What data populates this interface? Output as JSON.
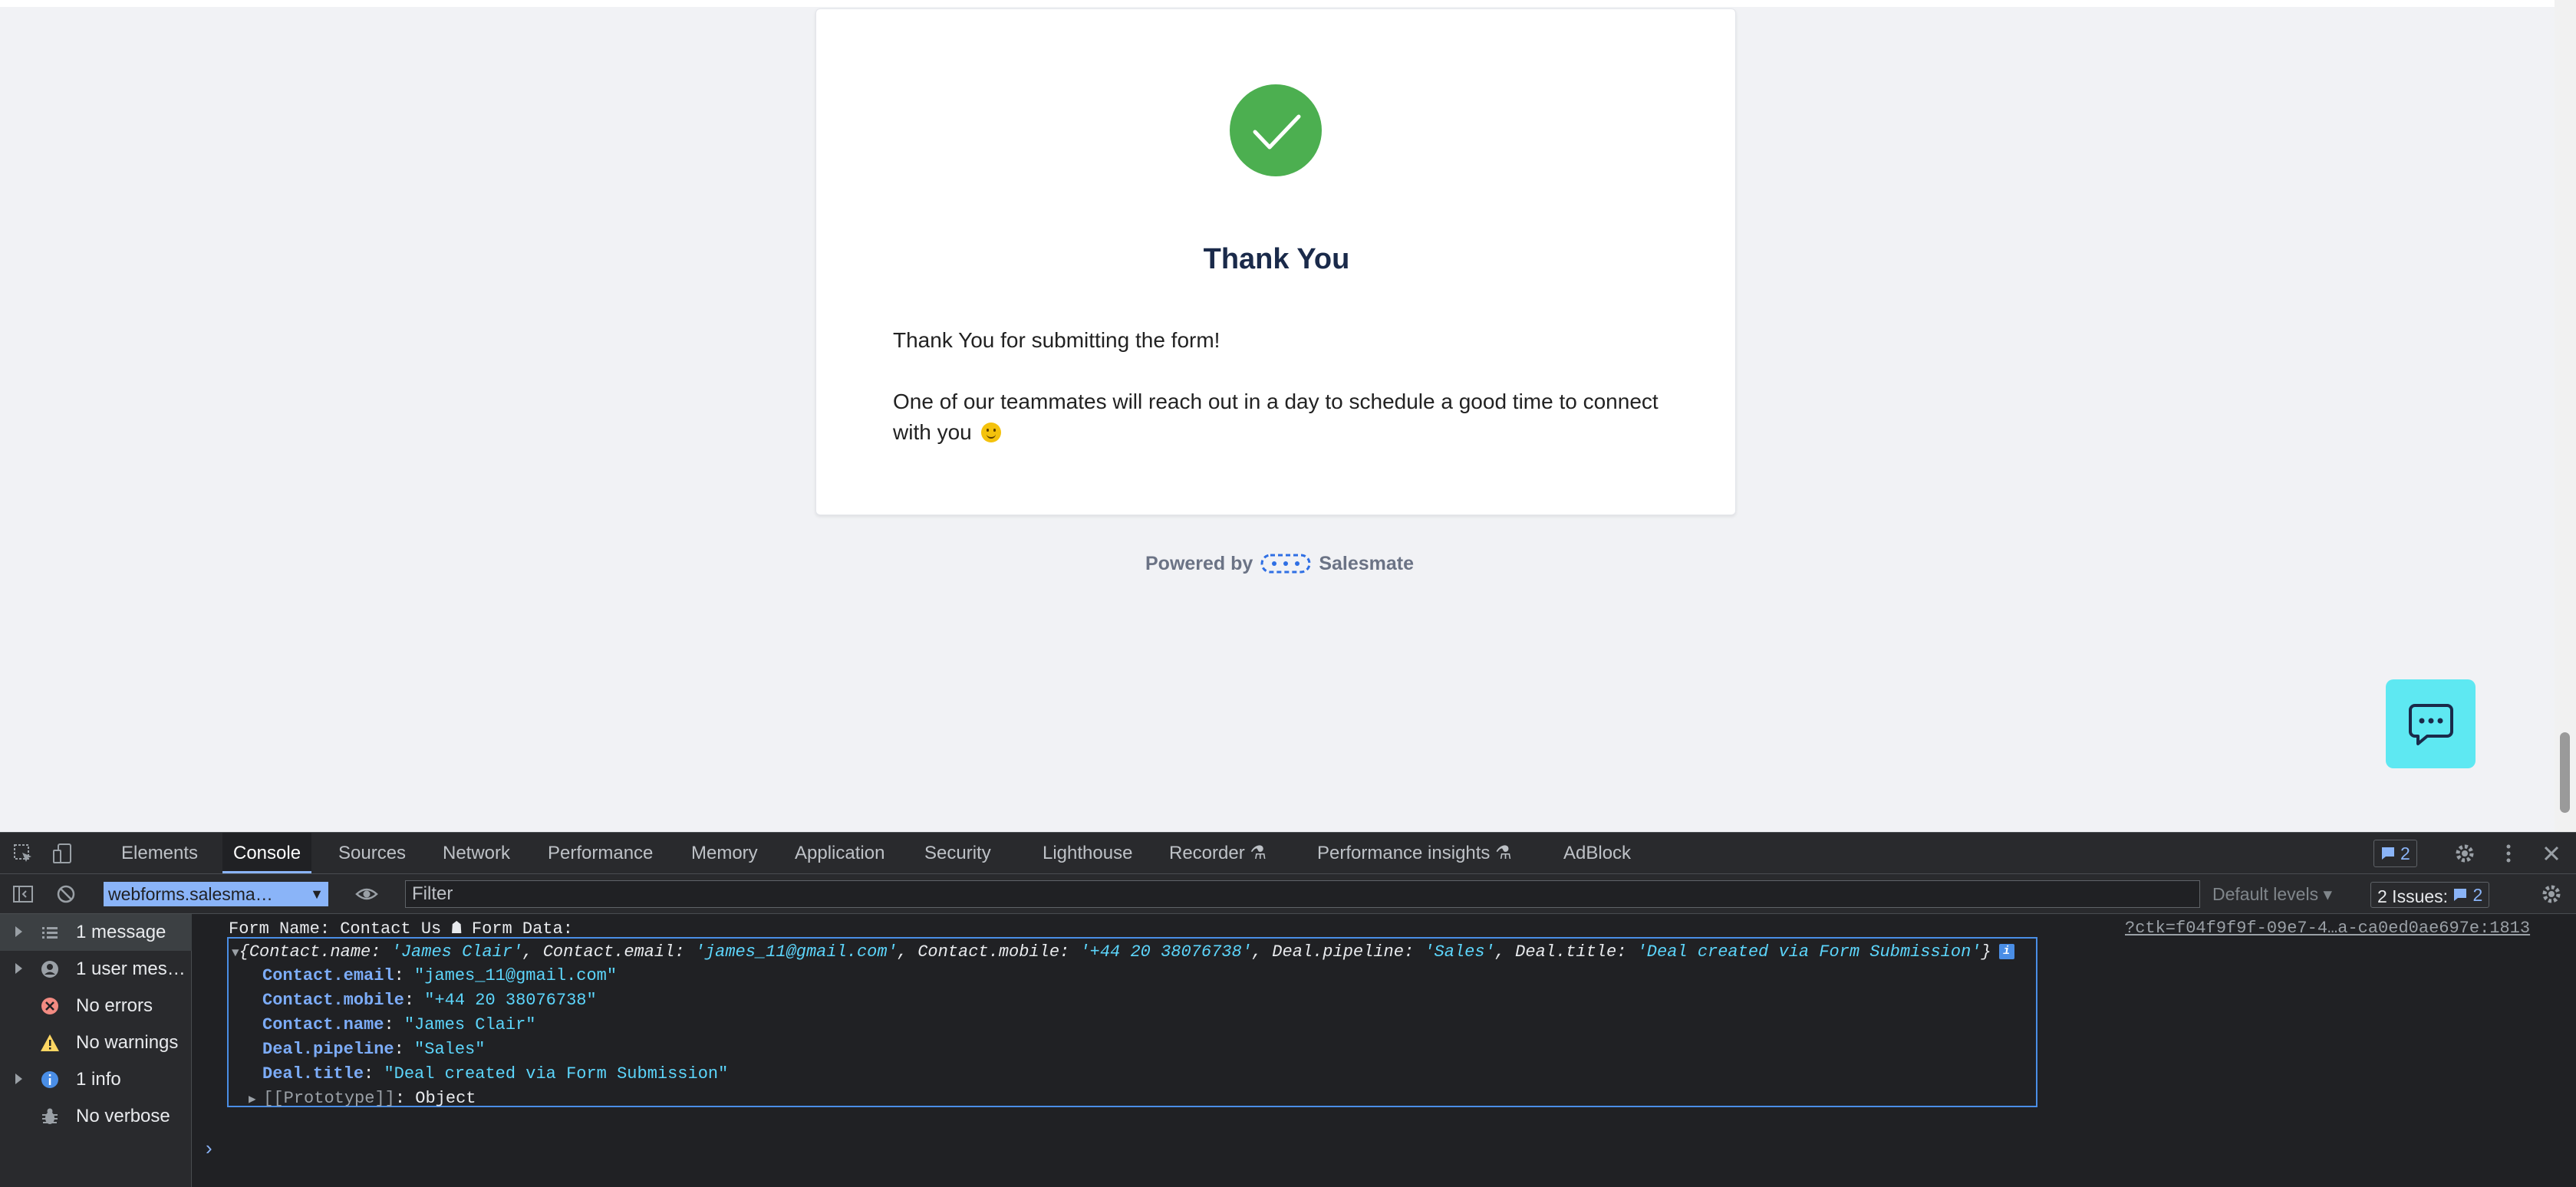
{
  "page": {
    "card": {
      "title": "Thank You",
      "line1": "Thank You for submitting the form!",
      "line2": "One of our teammates will reach out in a day to schedule a good time to connect with you"
    },
    "powered_by": {
      "prefix": "Powered by",
      "brand": "Salesmate"
    },
    "icons": {
      "success": "check-circle-icon",
      "chat": "chat-bubble-icon",
      "brand": "salesmate-logo-icon"
    },
    "colors": {
      "success": "#4caf50",
      "chat": "#5ee8f2",
      "title": "#1a2a4a"
    }
  },
  "devtools": {
    "tabs": [
      "Elements",
      "Console",
      "Sources",
      "Network",
      "Performance",
      "Memory",
      "Application",
      "Security",
      "Lighthouse",
      "Recorder",
      "Performance insights",
      "AdBlock"
    ],
    "active_tab": "Console",
    "issues_badge_count": "2",
    "toolbar": {
      "context": "webforms.salesma…",
      "filter_placeholder": "Filter",
      "levels": "Default levels",
      "issues_label": "2 Issues:",
      "issues_count": "2"
    },
    "sidebar": [
      {
        "label": "1 message",
        "icon": "list-icon"
      },
      {
        "label": "1 user mes…",
        "icon": "user-icon"
      },
      {
        "label": "No errors",
        "icon": "error-icon"
      },
      {
        "label": "No warnings",
        "icon": "warning-icon"
      },
      {
        "label": "1 info",
        "icon": "info-icon"
      },
      {
        "label": "No verbose",
        "icon": "bug-icon"
      }
    ],
    "console": {
      "header": "Form Name: Contact Us ☗ Form Data:",
      "source": "?ctk=f04f9f9f-09e7-4…a-ca0ed0ae697e:1813",
      "summary_parts": [
        {
          "t": "{",
          "c": "k"
        },
        {
          "t": "Contact.name",
          "c": "k"
        },
        {
          "t": ": ",
          "c": "k"
        },
        {
          "t": "'James Clair'",
          "c": "s"
        },
        {
          "t": ", ",
          "c": "k"
        },
        {
          "t": "Contact.email",
          "c": "k"
        },
        {
          "t": ": ",
          "c": "k"
        },
        {
          "t": "'james_11@gmail.com'",
          "c": "s"
        },
        {
          "t": ", ",
          "c": "k"
        },
        {
          "t": "Contact.mobile",
          "c": "k"
        },
        {
          "t": ": ",
          "c": "k"
        },
        {
          "t": "'+44 20 38076738'",
          "c": "s"
        },
        {
          "t": ", ",
          "c": "k"
        },
        {
          "t": "Deal.pipeline",
          "c": "k"
        },
        {
          "t": ": ",
          "c": "k"
        },
        {
          "t": "'Sales'",
          "c": "s"
        },
        {
          "t": ", ",
          "c": "k"
        },
        {
          "t": "Deal.title",
          "c": "k"
        },
        {
          "t": ": ",
          "c": "k"
        },
        {
          "t": "'Deal created via Form Submission'",
          "c": "s"
        },
        {
          "t": "}",
          "c": "k"
        }
      ],
      "props": [
        {
          "key": "Contact.email",
          "value": "\"james_11@gmail.com\""
        },
        {
          "key": "Contact.mobile",
          "value": "\"+44 20 38076738\""
        },
        {
          "key": "Contact.name",
          "value": "\"James Clair\""
        },
        {
          "key": "Deal.pipeline",
          "value": "\"Sales\""
        },
        {
          "key": "Deal.title",
          "value": "\"Deal created via Form Submission\""
        }
      ],
      "prototype": {
        "key": "[[Prototype]]",
        "value": "Object"
      }
    }
  }
}
